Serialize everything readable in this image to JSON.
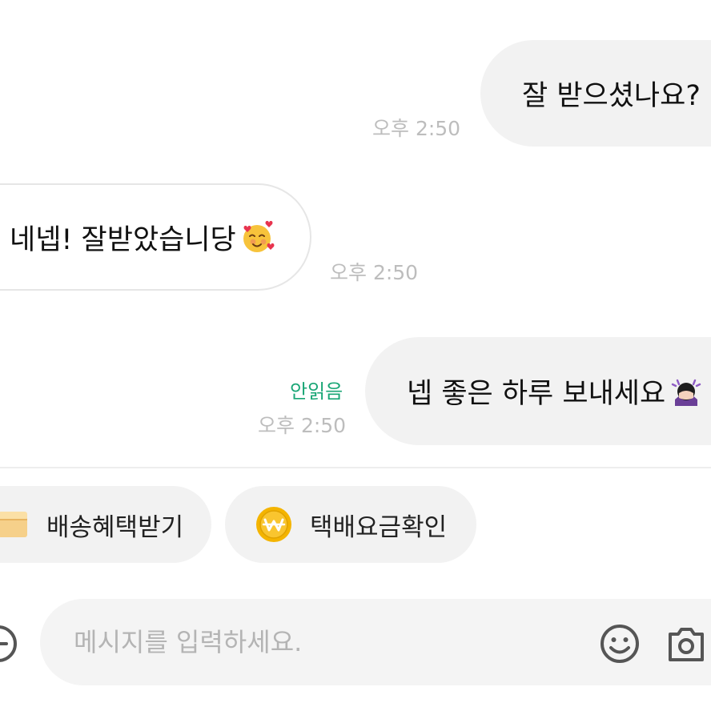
{
  "messages": [
    {
      "direction": "outgoing",
      "text": "잘 받으셨나요?",
      "time": "오후 2:50"
    },
    {
      "direction": "incoming",
      "text": "네넵! 잘받았습니당",
      "emoji": "smiling-face-with-hearts-emoji",
      "time": "오후 2:50"
    },
    {
      "direction": "outgoing",
      "text": "넵 좋은 하루 보내세요",
      "emoji": "girl-bowing-emoji",
      "time": "오후 2:50",
      "status": "안읽음"
    }
  ],
  "quick_actions": [
    {
      "label": "배송혜택받기",
      "icon": "package-box-icon"
    },
    {
      "label": "택배요금확인",
      "icon": "won-coin-icon"
    }
  ],
  "composer": {
    "placeholder": "메시지를 입력하세요.",
    "value": ""
  },
  "colors": {
    "bubble": "#f2f2f2",
    "timestamp": "#bdbdbd",
    "unread": "#1aa676",
    "coin": "#f4b400"
  }
}
